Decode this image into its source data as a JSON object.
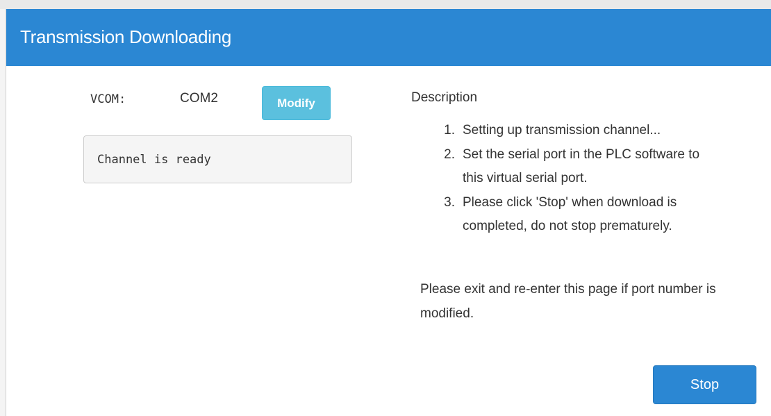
{
  "dialog": {
    "title": "Transmission Downloading",
    "header_color": "#2b87d3"
  },
  "vcom": {
    "label": "VCOM:",
    "value": "COM2",
    "modify_label": "Modify"
  },
  "status": {
    "text": "Channel is ready"
  },
  "description": {
    "title": "Description",
    "steps": [
      {
        "num": "1.",
        "text": "Setting up transmission channel..."
      },
      {
        "num": "2.",
        "text": "Set the serial port in the PLC software to this virtual serial port."
      },
      {
        "num": "3.",
        "text": "Please click 'Stop' when download is completed, do not stop prematurely."
      }
    ],
    "note": "Please exit and re-enter this page if port number is modified."
  },
  "footer": {
    "stop_label": "Stop"
  }
}
